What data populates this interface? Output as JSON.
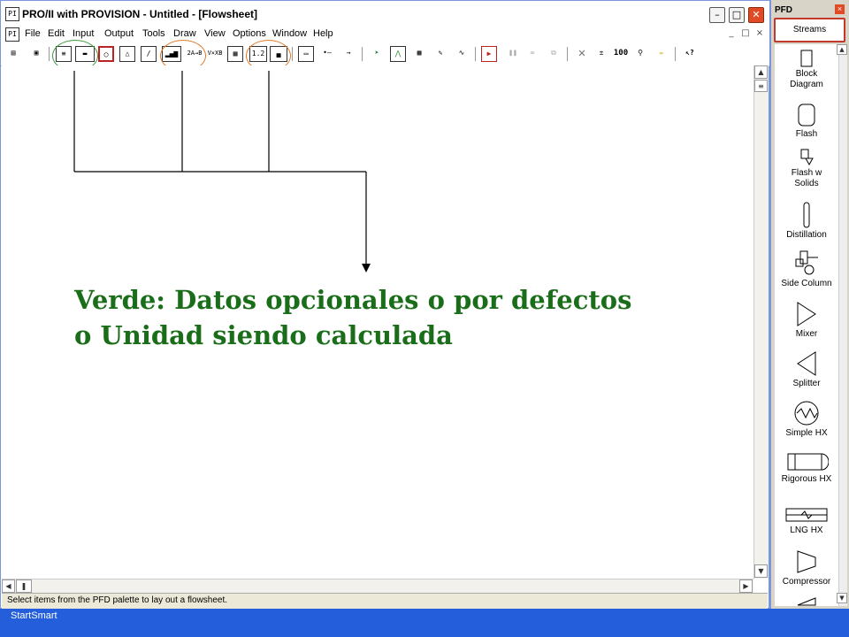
{
  "window": {
    "title": "PRO/II with PROVISION - Untitled - [Flowsheet]",
    "min_label": "–",
    "max_label": "□",
    "close_label": "✕"
  },
  "menu": {
    "items": [
      "File",
      "Edit",
      "Input",
      "Output",
      "Tools",
      "Draw",
      "View",
      "Options",
      "Window",
      "Help"
    ],
    "mdi_min": "_",
    "mdi_restore": "□",
    "mdi_close": "×"
  },
  "toolbar": {
    "sum_label": "2A→B",
    "math_label": "V×XB",
    "numeric_label": "1.2",
    "zoom_label": "100"
  },
  "annotation": {
    "line1": "Verde: Datos opcionales o por defectos",
    "line2": "o Unidad siendo calculada"
  },
  "status_bar": {
    "text": "Select items from the PFD palette to lay out a flowsheet."
  },
  "taskbar": {
    "label": "StartSmart"
  },
  "pfd_palette": {
    "title": "PFD",
    "close": "×",
    "streams": "Streams",
    "items": [
      {
        "label_1": "Block",
        "label_2": "Diagram",
        "icon": "block-diagram-icon"
      },
      {
        "label_1": "Flash",
        "label_2": "",
        "icon": "flash-icon"
      },
      {
        "label_1": "Flash w",
        "label_2": "Solids",
        "icon": "flash-solids-icon"
      },
      {
        "label_1": "Distillation",
        "label_2": "",
        "icon": "distillation-icon"
      },
      {
        "label_1": "Side Column",
        "label_2": "",
        "icon": "side-column-icon"
      },
      {
        "label_1": "Mixer",
        "label_2": "",
        "icon": "mixer-icon"
      },
      {
        "label_1": "Splitter",
        "label_2": "",
        "icon": "splitter-icon"
      },
      {
        "label_1": "Simple HX",
        "label_2": "",
        "icon": "simple-hx-icon"
      },
      {
        "label_1": "Rigorous HX",
        "label_2": "",
        "icon": "rigorous-hx-icon"
      },
      {
        "label_1": "LNG HX",
        "label_2": "",
        "icon": "lng-hx-icon"
      },
      {
        "label_1": "Compressor",
        "label_2": "",
        "icon": "compressor-icon"
      }
    ]
  },
  "colors": {
    "annotation_green": "#1a6e1a",
    "highlight_orange": "#e07a28",
    "highlight_green": "#3c9a3c",
    "selection_red": "#c0392b",
    "taskbar_blue": "#245edb"
  }
}
